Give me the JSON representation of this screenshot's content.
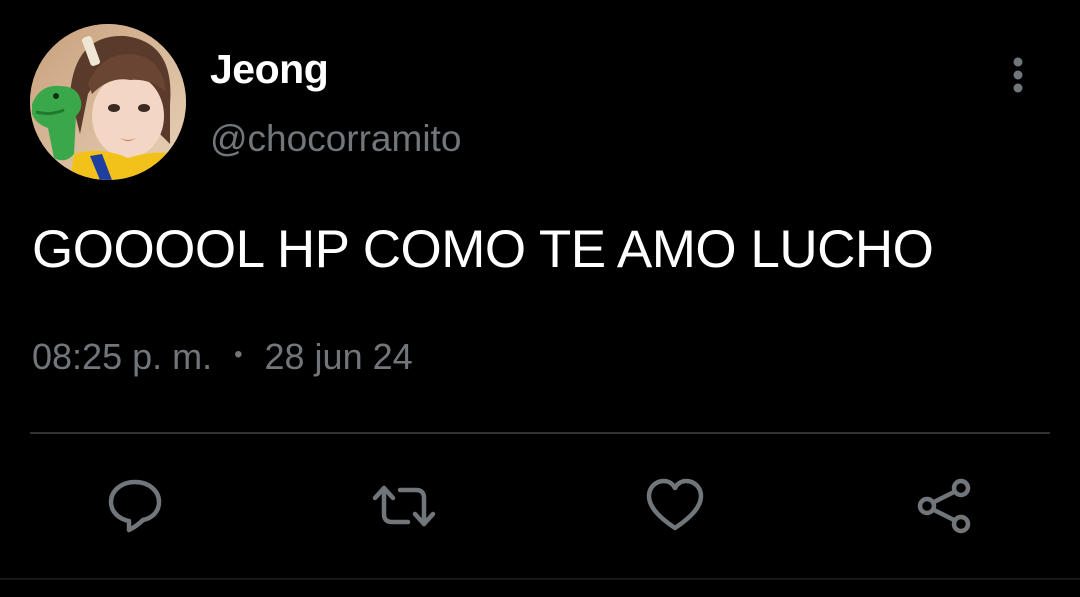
{
  "tweet": {
    "author": {
      "display_name": "Jeong",
      "handle": "@chocorramito",
      "avatar_icon": "avatar-photo"
    },
    "text": "GOOOOL HP COMO TE AMO LUCHO",
    "time": "08:25 p. m.",
    "separator": "•",
    "date": "28 jun 24"
  },
  "actions": [
    {
      "name": "reply",
      "icon": "comment-icon"
    },
    {
      "name": "retweet",
      "icon": "retweet-icon"
    },
    {
      "name": "like",
      "icon": "heart-icon"
    },
    {
      "name": "share",
      "icon": "share-icon"
    }
  ],
  "menu": {
    "icon": "more-vertical-icon"
  },
  "colors": {
    "background": "#000000",
    "primary_text": "#ffffff",
    "secondary_text": "#71767b",
    "divider": "#2f3336"
  }
}
